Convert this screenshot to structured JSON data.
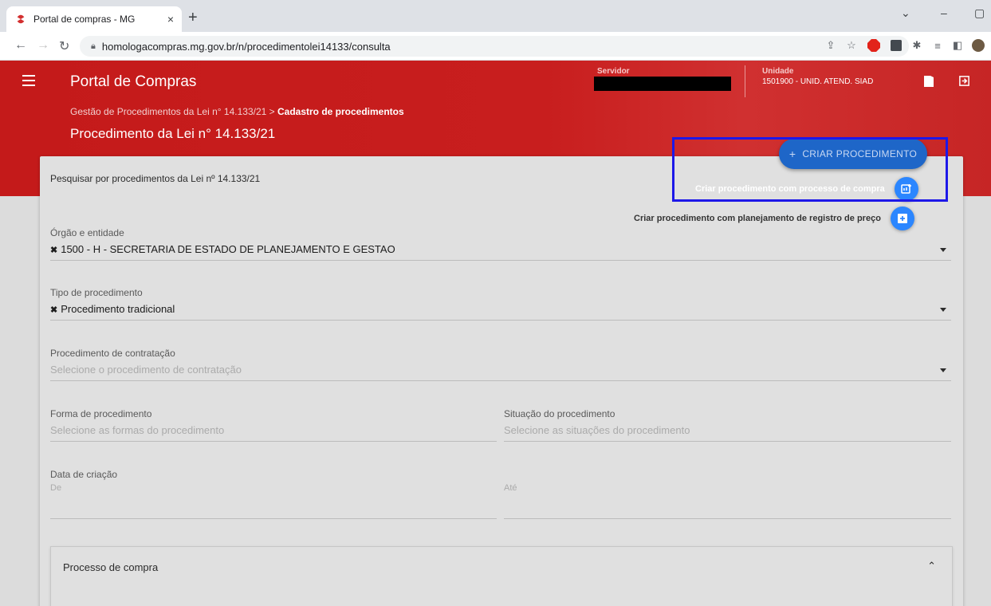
{
  "browser": {
    "tab_title": "Portal de compras - MG",
    "tab_close": "×",
    "new_tab": "+",
    "url": "homologacompras.mg.gov.br/n/procedimentolei14133/consulta",
    "window_controls": {
      "chevron": "⌄",
      "minimize": "–",
      "restore": "▢"
    },
    "extensions": [
      "share-icon",
      "star-icon",
      "adblock-icon",
      "selenium-icon",
      "puzzle-icon",
      "reading-list-icon",
      "sidepanel-icon",
      "profile-avatar"
    ]
  },
  "header": {
    "app_title": "Portal de Compras",
    "server_label": "Servidor",
    "unit_label": "Unidade",
    "unit_value": "1501900 - UNID. ATEND. SIAD",
    "breadcrumb_prefix": "Gestão de Procedimentos da Lei n° 14.133/21 > ",
    "breadcrumb_current": "Cadastro de procedimentos",
    "page_title": "Procedimento da Lei n° 14.133/21"
  },
  "search": {
    "title": "Pesquisar por procedimentos da Lei nº 14.133/21",
    "orgao": {
      "label": "Órgão e entidade",
      "value": "1500 - H - SECRETARIA DE ESTADO DE PLANEJAMENTO E GESTAO"
    },
    "tipo": {
      "label": "Tipo de procedimento",
      "value": "Procedimento tradicional"
    },
    "contratacao": {
      "label": "Procedimento de contratação",
      "placeholder": "Selecione o procedimento de contratação"
    },
    "forma": {
      "label": "Forma de procedimento",
      "placeholder": "Selecione as formas do procedimento"
    },
    "situacao": {
      "label": "Situação do procedimento",
      "placeholder": "Selecione as situações do procedimento"
    },
    "data_criacao": {
      "label": "Data de criação",
      "from": "De",
      "to": "Até"
    }
  },
  "panel": {
    "title": "Processo de compra"
  },
  "fab": {
    "label": "CRIAR PROCEDIMENTO",
    "plus": "+",
    "option1": "Criar procedimento com processo de compra",
    "option2": "Criar procedimento com planejamento de registro de preço"
  },
  "colors": {
    "brand_red": "#c41a1a",
    "fab_blue": "#1e66c8",
    "highlight_blue": "#1d18e8"
  }
}
